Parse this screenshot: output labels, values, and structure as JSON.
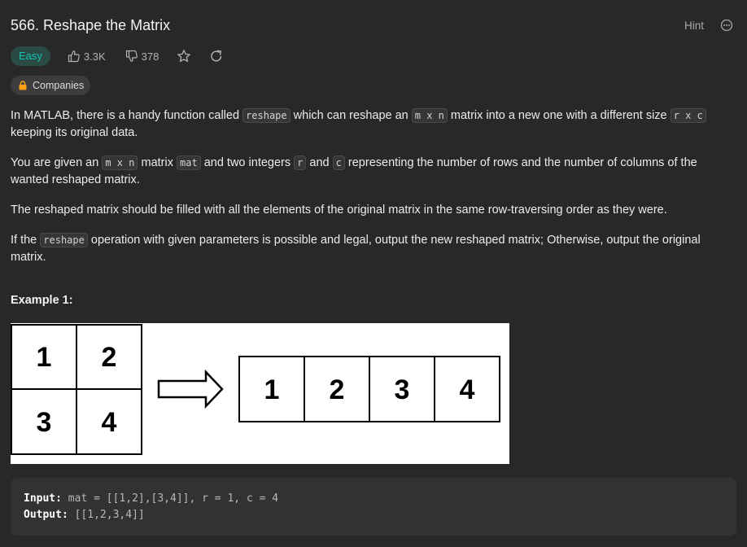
{
  "problem": {
    "title": "566. Reshape the Matrix",
    "hint_label": "Hint",
    "difficulty": "Easy",
    "likes": "3.3K",
    "dislikes": "378",
    "companies_label": "Companies"
  },
  "description": {
    "p1": {
      "t1": "In MATLAB, there is a handy function called ",
      "c1": "reshape",
      "t2": " which can reshape an ",
      "c2": "m x n",
      "t3": " matrix into a new one with a different size ",
      "c3": "r x c",
      "t4": " keeping its original data."
    },
    "p2": {
      "t1": "You are given an ",
      "c1": "m x n",
      "t2": " matrix ",
      "c2": "mat",
      "t3": " and two integers ",
      "c3": "r",
      "t4": " and ",
      "c4": "c",
      "t5": " representing the number of rows and the number of columns of the wanted reshaped matrix."
    },
    "p3": "The reshaped matrix should be filled with all the elements of the original matrix in the same row-traversing order as they were.",
    "p4": {
      "t1": "If the ",
      "c1": "reshape",
      "t2": " operation with given parameters is possible and legal, output the new reshaped matrix; Otherwise, output the original matrix."
    }
  },
  "example": {
    "title": "Example 1:",
    "input_matrix": [
      "1",
      "2",
      "3",
      "4"
    ],
    "output_matrix": [
      "1",
      "2",
      "3",
      "4"
    ],
    "input_label": "Input:",
    "input_value": "mat = [[1,2],[3,4]], r = 1, c = 4",
    "output_label": "Output:",
    "output_value": "[[1,2,3,4]]"
  },
  "colors": {
    "background": "#282828",
    "easy_badge_text": "#17c3b2",
    "easy_badge_bg": "#2a4a44",
    "lock_icon": "#ffa116"
  }
}
